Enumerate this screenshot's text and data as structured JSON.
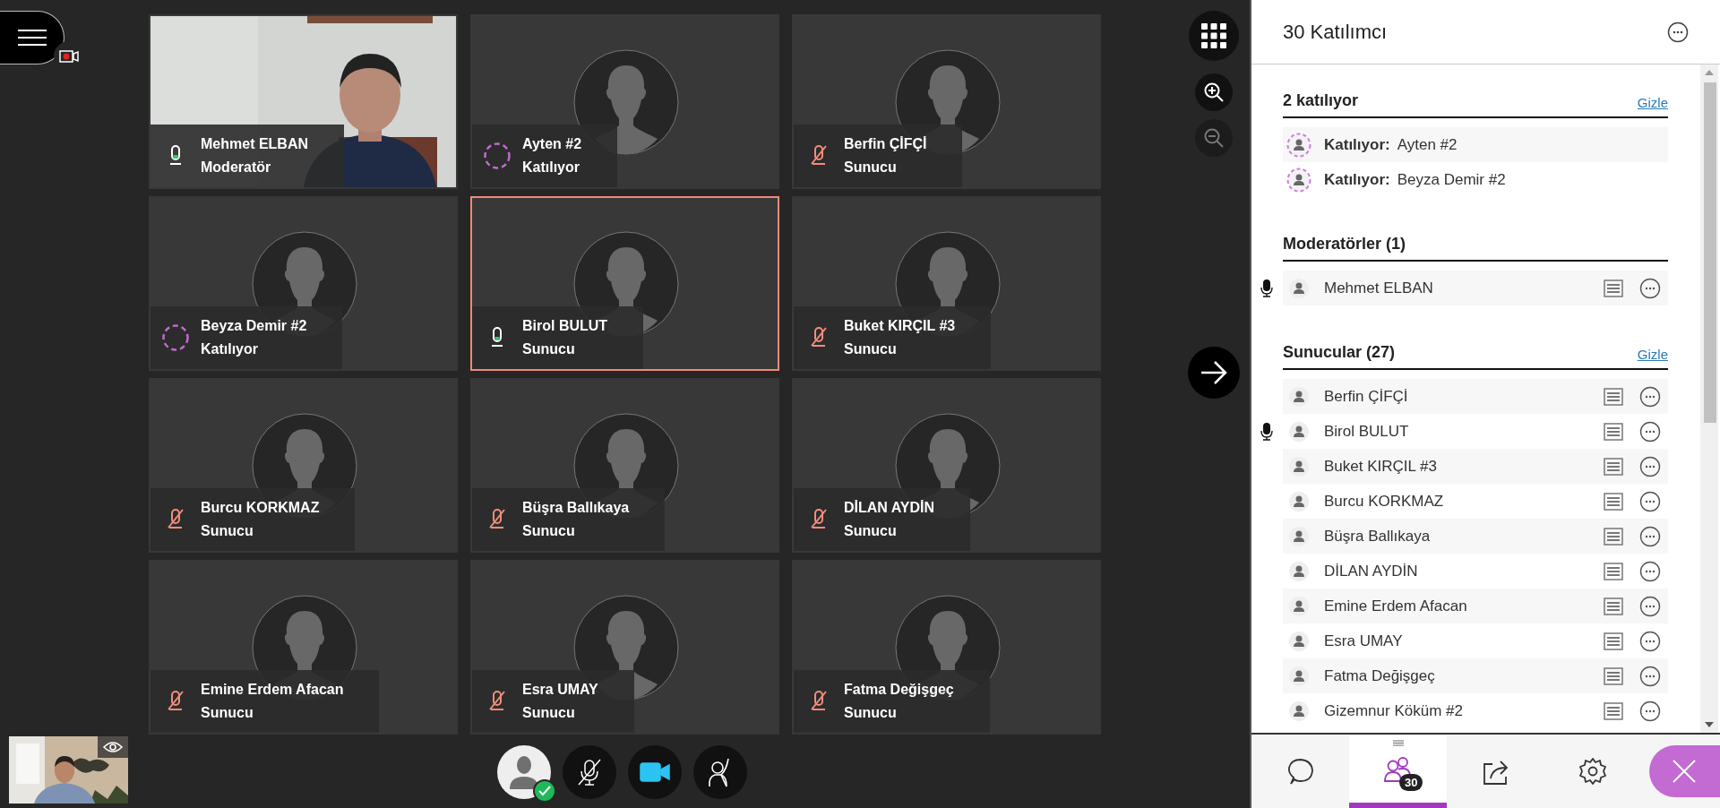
{
  "session": {
    "recording": true
  },
  "tiles": [
    {
      "name": "Mehmet ELBAN",
      "role": "Moderatör",
      "kind": "talking",
      "video": true,
      "selected": false
    },
    {
      "name": "Ayten #2",
      "role": "Katılıyor",
      "kind": "joining",
      "video": false,
      "selected": false
    },
    {
      "name": "Berfin ÇİFÇİ",
      "role": "Sunucu",
      "kind": "muted",
      "video": false,
      "selected": false
    },
    {
      "name": "Beyza Demir #2",
      "role": "Katılıyor",
      "kind": "joining",
      "video": false,
      "selected": false
    },
    {
      "name": "Birol BULUT",
      "role": "Sunucu",
      "kind": "talking",
      "video": false,
      "selected": true
    },
    {
      "name": "Buket KIRÇIL #3",
      "role": "Sunucu",
      "kind": "muted",
      "video": false,
      "selected": false
    },
    {
      "name": "Burcu KORKMAZ",
      "role": "Sunucu",
      "kind": "muted",
      "video": false,
      "selected": false
    },
    {
      "name": "Büşra Ballıkaya",
      "role": "Sunucu",
      "kind": "muted",
      "video": false,
      "selected": false
    },
    {
      "name": "DİLAN AYDİN",
      "role": "Sunucu",
      "kind": "muted",
      "video": false,
      "selected": false
    },
    {
      "name": "Emine Erdem Afacan",
      "role": "Sunucu",
      "kind": "muted",
      "video": false,
      "selected": false
    },
    {
      "name": "Esra UMAY",
      "role": "Sunucu",
      "kind": "muted",
      "video": false,
      "selected": false
    },
    {
      "name": "Fatma Değişgeç",
      "role": "Sunucu",
      "kind": "muted",
      "video": false,
      "selected": false
    }
  ],
  "controls": {
    "mic_on": false,
    "camera_on": true
  },
  "panel": {
    "title": "30 Katılımcı",
    "sections": [
      {
        "title": "2 katılıyor",
        "action": "Gizle",
        "items": [
          {
            "kind": "joining",
            "prefix": "Katılıyor:",
            "name": "Ayten #2"
          },
          {
            "kind": "joining",
            "prefix": "Katılıyor:",
            "name": "Beyza Demir #2"
          }
        ]
      },
      {
        "title": "Moderatörler (1)",
        "items": [
          {
            "kind": "member",
            "name": "Mehmet ELBAN",
            "talking": true
          }
        ]
      },
      {
        "title": "Sunucular (27)",
        "action": "Gizle",
        "items": [
          {
            "kind": "member",
            "name": "Berfin ÇİFÇİ",
            "talking": false
          },
          {
            "kind": "member",
            "name": "Birol BULUT",
            "talking": true
          },
          {
            "kind": "member",
            "name": "Buket KIRÇIL #3",
            "talking": false
          },
          {
            "kind": "member",
            "name": "Burcu KORKMAZ",
            "talking": false
          },
          {
            "kind": "member",
            "name": "Büşra Ballıkaya",
            "talking": false
          },
          {
            "kind": "member",
            "name": "DİLAN AYDİN",
            "talking": false
          },
          {
            "kind": "member",
            "name": "Emine Erdem Afacan",
            "talking": false
          },
          {
            "kind": "member",
            "name": "Esra UMAY",
            "talking": false
          },
          {
            "kind": "member",
            "name": "Fatma Değişgeç",
            "talking": false
          },
          {
            "kind": "member",
            "name": "Gizemnur Köküm #2",
            "talking": false
          }
        ]
      }
    ]
  },
  "tabs": [
    {
      "kind": "chat",
      "selected": false
    },
    {
      "kind": "participants",
      "selected": true,
      "badge": "30"
    },
    {
      "kind": "share",
      "selected": false
    },
    {
      "kind": "settings",
      "selected": false
    }
  ]
}
